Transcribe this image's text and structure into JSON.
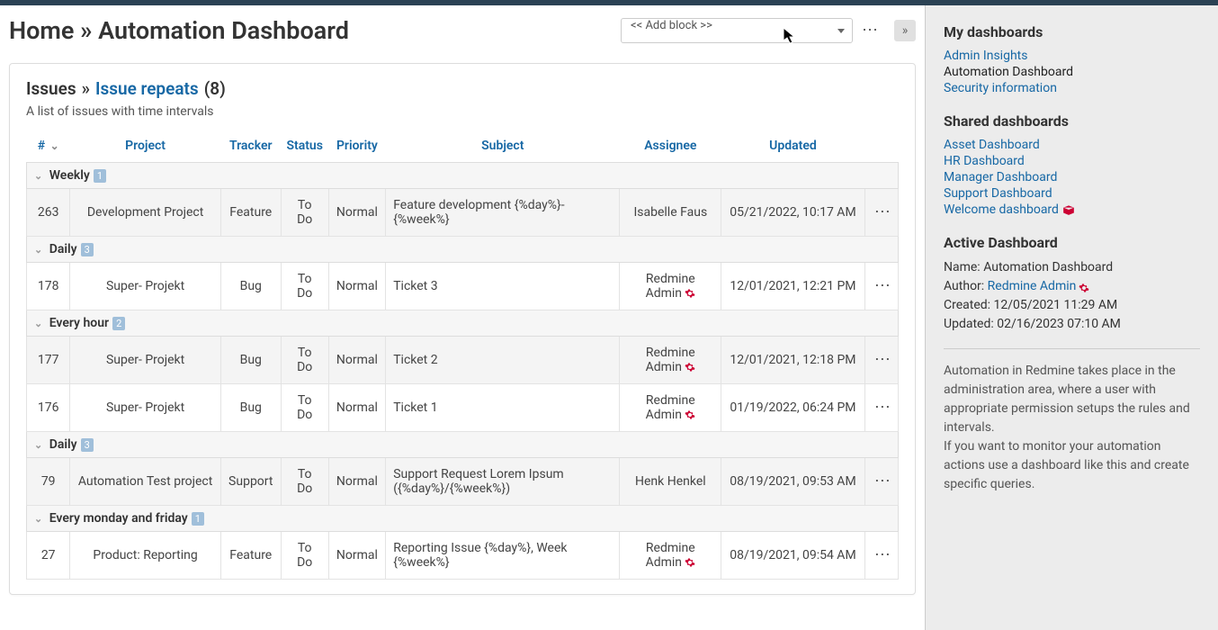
{
  "header": {
    "home_label": "Home",
    "crumb_sep": "»",
    "dashboard_name": "Automation Dashboard",
    "add_block_placeholder": "<< Add block >>"
  },
  "panel": {
    "issues_label": "Issues",
    "sep": "»",
    "title_link": "Issue repeats",
    "count_str": "(8)",
    "subtitle": "A list of issues with time intervals"
  },
  "columns": {
    "id": "#",
    "project": "Project",
    "tracker": "Tracker",
    "status": "Status",
    "priority": "Priority",
    "subject": "Subject",
    "assignee": "Assignee",
    "updated": "Updated"
  },
  "groups": [
    {
      "label": "Weekly",
      "count": "1",
      "rows": [
        {
          "id": "263",
          "project": "Development Project",
          "tracker": "Feature",
          "status": "To Do",
          "priority": "Normal",
          "subject": "Feature development {%day%}-{%week%}",
          "assignee": "Isabelle Faus",
          "gear": false,
          "updated": "05/21/2022, 10:17 AM",
          "alt": true
        }
      ]
    },
    {
      "label": "Daily",
      "count": "3",
      "rows": [
        {
          "id": "178",
          "project": "Super- Projekt",
          "tracker": "Bug",
          "status": "To Do",
          "priority": "Normal",
          "subject": "Ticket 3",
          "assignee": "Redmine Admin",
          "gear": true,
          "updated": "12/01/2021, 12:21 PM",
          "alt": false
        }
      ]
    },
    {
      "label": "Every hour",
      "count": "2",
      "rows": [
        {
          "id": "177",
          "project": "Super- Projekt",
          "tracker": "Bug",
          "status": "To Do",
          "priority": "Normal",
          "subject": "Ticket 2",
          "assignee": "Redmine Admin",
          "gear": true,
          "updated": "12/01/2021, 12:18 PM",
          "alt": true
        },
        {
          "id": "176",
          "project": "Super- Projekt",
          "tracker": "Bug",
          "status": "To Do",
          "priority": "Normal",
          "subject": "Ticket 1",
          "assignee": "Redmine Admin",
          "gear": true,
          "updated": "01/19/2022, 06:24 PM",
          "alt": false
        }
      ]
    },
    {
      "label": "Daily",
      "count": "3",
      "rows": [
        {
          "id": "79",
          "project": "Automation Test project",
          "tracker": "Support",
          "status": "To Do",
          "priority": "Normal",
          "subject": "Support Request Lorem Ipsum ({%day%}/{%week%})",
          "assignee": "Henk Henkel",
          "gear": false,
          "updated": "08/19/2021, 09:53 AM",
          "alt": true
        }
      ]
    },
    {
      "label": "Every monday and friday",
      "count": "1",
      "rows": [
        {
          "id": "27",
          "project": "Product: Reporting",
          "tracker": "Feature",
          "status": "To Do",
          "priority": "Normal",
          "subject": "Reporting Issue {%day%}, Week {%week%}",
          "assignee": "Redmine Admin",
          "gear": true,
          "updated": "08/19/2021, 09:54 AM",
          "alt": false
        }
      ]
    }
  ],
  "sidebar": {
    "my_heading": "My dashboards",
    "my_items": [
      {
        "label": "Admin Insights",
        "active": false
      },
      {
        "label": "Automation Dashboard",
        "active": true
      },
      {
        "label": "Security information",
        "active": false
      }
    ],
    "shared_heading": "Shared dashboards",
    "shared_items": [
      {
        "label": "Asset Dashboard"
      },
      {
        "label": "HR Dashboard"
      },
      {
        "label": "Manager Dashboard"
      },
      {
        "label": "Support Dashboard"
      },
      {
        "label": "Welcome dashboard",
        "icon": true
      }
    ],
    "active_heading": "Active Dashboard",
    "name_label": "Name:",
    "name_value": "Automation Dashboard",
    "author_label": "Author:",
    "author_value": "Redmine Admin",
    "created_label": "Created:",
    "created_value": "12/05/2021 11:29 AM",
    "updated_label": "Updated:",
    "updated_value": "02/16/2023 07:10 AM",
    "descr1": "Automation in Redmine takes place in the administration area, where a user with appropriate permission setups the rules and intervals.",
    "descr2": "If you want to monitor your automation actions use a dashboard like this and create specific queries."
  }
}
